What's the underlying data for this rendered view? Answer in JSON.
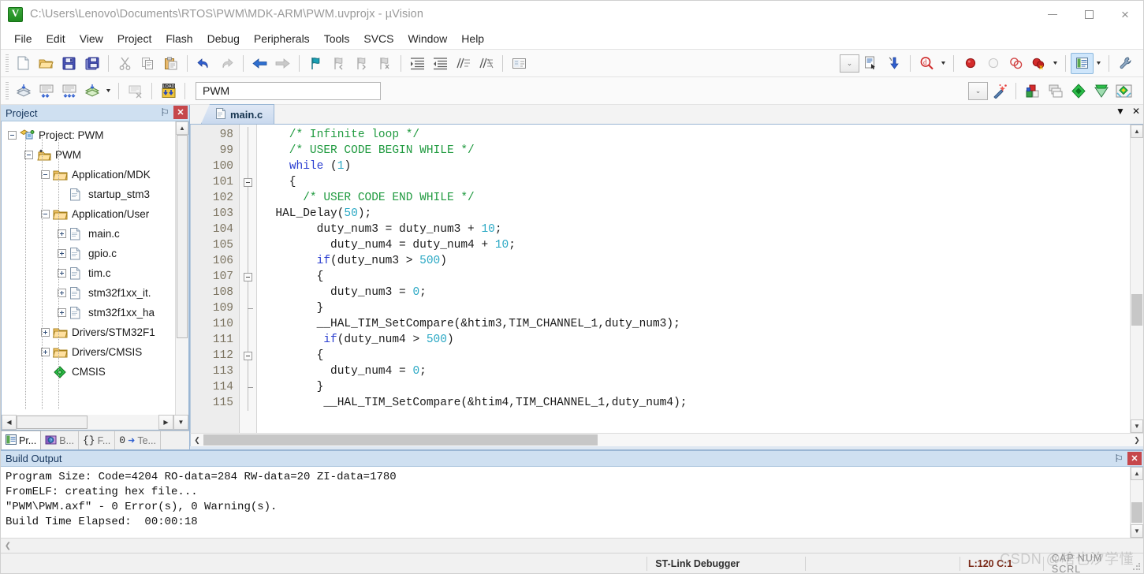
{
  "window": {
    "title": "C:\\Users\\Lenovo\\Documents\\RTOS\\PWM\\MDK-ARM\\PWM.uvprojx - µVision",
    "minimize_label": "",
    "maximize_label": "",
    "close_label": "×"
  },
  "menu": {
    "items": [
      {
        "label": "File"
      },
      {
        "label": "Edit"
      },
      {
        "label": "View"
      },
      {
        "label": "Project"
      },
      {
        "label": "Flash"
      },
      {
        "label": "Debug"
      },
      {
        "label": "Peripherals"
      },
      {
        "label": "Tools"
      },
      {
        "label": "SVCS"
      },
      {
        "label": "Window"
      },
      {
        "label": "Help"
      }
    ]
  },
  "toolbar_main": {
    "buttons": [
      {
        "name": "new-file-icon",
        "tooltip": "New"
      },
      {
        "name": "open-file-icon",
        "tooltip": "Open"
      },
      {
        "name": "save-icon",
        "tooltip": "Save"
      },
      {
        "name": "save-all-icon",
        "tooltip": "Save All"
      },
      {
        "name": "cut-icon",
        "tooltip": "Cut"
      },
      {
        "name": "copy-icon",
        "tooltip": "Copy"
      },
      {
        "name": "paste-icon",
        "tooltip": "Paste"
      },
      {
        "name": "undo-icon",
        "tooltip": "Undo"
      },
      {
        "name": "redo-icon",
        "tooltip": "Redo"
      },
      {
        "name": "navigate-back-icon",
        "tooltip": "Back"
      },
      {
        "name": "navigate-forward-icon",
        "tooltip": "Forward"
      },
      {
        "name": "bookmark-toggle-icon",
        "tooltip": "Insert/Remove Bookmark"
      },
      {
        "name": "bookmark-prev-icon",
        "tooltip": "Previous Bookmark"
      },
      {
        "name": "bookmark-next-icon",
        "tooltip": "Next Bookmark"
      },
      {
        "name": "bookmark-clear-icon",
        "tooltip": "Clear All Bookmarks"
      },
      {
        "name": "indent-icon",
        "tooltip": "Indent"
      },
      {
        "name": "outdent-icon",
        "tooltip": "Outdent"
      },
      {
        "name": "comment-icon",
        "tooltip": "Comment"
      },
      {
        "name": "uncomment-icon",
        "tooltip": "Uncomment"
      },
      {
        "name": "open-configuration-icon",
        "tooltip": "Configuration Wizard"
      }
    ]
  },
  "toolbar_right": {
    "buttons": [
      {
        "name": "target-options-dropdown",
        "tooltip": "Select Target"
      },
      {
        "name": "show-disassembly-icon",
        "tooltip": "Disassembly Window"
      },
      {
        "name": "start-debug-icon",
        "tooltip": "Start/Stop Debug Session"
      },
      {
        "name": "find-in-files-icon",
        "tooltip": "Find in Files"
      },
      {
        "name": "breakpoint-insert-icon",
        "tooltip": "Insert/Remove Breakpoint"
      },
      {
        "name": "breakpoint-disable-icon",
        "tooltip": "Enable/Disable Breakpoint"
      },
      {
        "name": "breakpoint-disable-all-icon",
        "tooltip": "Disable All Breakpoints"
      },
      {
        "name": "breakpoint-kill-all-icon",
        "tooltip": "Kill All Breakpoints"
      },
      {
        "name": "manage-windows-icon",
        "tooltip": "Manage Window Layout"
      },
      {
        "name": "configure-tools-icon",
        "tooltip": "Configure"
      }
    ]
  },
  "toolbar_build": {
    "buttons": [
      {
        "name": "translate-icon",
        "tooltip": "Translate File"
      },
      {
        "name": "build-icon",
        "tooltip": "Build"
      },
      {
        "name": "rebuild-icon",
        "tooltip": "Rebuild"
      },
      {
        "name": "batch-build-icon",
        "tooltip": "Batch Build"
      },
      {
        "name": "stop-build-icon",
        "tooltip": "Stop Build"
      },
      {
        "name": "download-icon",
        "tooltip": "Download",
        "label": "LOAD"
      },
      {
        "name": "target-wizard-icon",
        "tooltip": "Start Wizard"
      },
      {
        "name": "target-options-icon",
        "tooltip": "Options for Target"
      },
      {
        "name": "manage-project-items-icon",
        "tooltip": "Manage Project Items"
      },
      {
        "name": "pack-installer-icon",
        "tooltip": "Pack Installer"
      },
      {
        "name": "manage-rte-icon",
        "tooltip": "Manage Run-Time Environment"
      },
      {
        "name": "select-software-packs-icon",
        "tooltip": "Select Software Packs"
      }
    ],
    "target_value": "PWM"
  },
  "project_panel": {
    "title": "Project",
    "pin_label": "⚐",
    "close_label": "✕",
    "tree": [
      {
        "label": "Project: PWM",
        "indent": 0,
        "expander": "minus",
        "icon": "project-icon"
      },
      {
        "label": "PWM",
        "indent": 1,
        "expander": "minus",
        "icon": "target-icon"
      },
      {
        "label": "Application/MDK",
        "indent": 2,
        "expander": "minus",
        "icon": "folder-icon"
      },
      {
        "label": "startup_stm3",
        "indent": 3,
        "expander": "none",
        "icon": "file-icon"
      },
      {
        "label": "Application/User",
        "indent": 2,
        "expander": "minus",
        "icon": "folder-icon"
      },
      {
        "label": "main.c",
        "indent": 3,
        "expander": "plus",
        "icon": "file-icon"
      },
      {
        "label": "gpio.c",
        "indent": 3,
        "expander": "plus",
        "icon": "file-icon"
      },
      {
        "label": "tim.c",
        "indent": 3,
        "expander": "plus",
        "icon": "file-icon"
      },
      {
        "label": "stm32f1xx_it.",
        "indent": 3,
        "expander": "plus",
        "icon": "file-icon"
      },
      {
        "label": "stm32f1xx_ha",
        "indent": 3,
        "expander": "plus",
        "icon": "file-icon"
      },
      {
        "label": "Drivers/STM32F1",
        "indent": 2,
        "expander": "plus",
        "icon": "folder-icon"
      },
      {
        "label": "Drivers/CMSIS",
        "indent": 2,
        "expander": "plus",
        "icon": "folder-icon"
      },
      {
        "label": "CMSIS",
        "indent": 2,
        "expander": "none",
        "icon": "cmsis-icon"
      }
    ],
    "tabs": [
      {
        "label": "Pr...",
        "icon": "project-tab-icon",
        "selected": true
      },
      {
        "label": "B...",
        "icon": "books-tab-icon",
        "selected": false
      },
      {
        "label": "F...",
        "icon": "functions-tab-icon",
        "selected": false
      },
      {
        "label": "Te...",
        "icon": "templates-tab-icon",
        "selected": false
      }
    ]
  },
  "editor": {
    "tabs": [
      {
        "label": "main.c",
        "icon": "c-file-icon",
        "selected": true
      }
    ],
    "tab_dropdown_label": "▼",
    "tab_close_label": "✕",
    "first_line": 98,
    "lines": [
      {
        "n": 98,
        "fold": "none",
        "segments": [
          {
            "t": "    /* Infinite loop */",
            "c": "comment"
          }
        ]
      },
      {
        "n": 99,
        "fold": "none",
        "segments": [
          {
            "t": "    /* USER CODE BEGIN WHILE */",
            "c": "comment"
          }
        ]
      },
      {
        "n": 100,
        "fold": "none",
        "segments": [
          {
            "t": "    ",
            "c": "plain"
          },
          {
            "t": "while",
            "c": "keyword"
          },
          {
            "t": " (",
            "c": "plain"
          },
          {
            "t": "1",
            "c": "number"
          },
          {
            "t": ")",
            "c": "plain"
          }
        ]
      },
      {
        "n": 101,
        "fold": "start",
        "segments": [
          {
            "t": "    {",
            "c": "plain"
          }
        ]
      },
      {
        "n": 102,
        "fold": "none",
        "segments": [
          {
            "t": "      /* USER CODE END WHILE */",
            "c": "comment"
          }
        ]
      },
      {
        "n": 103,
        "fold": "none",
        "segments": [
          {
            "t": "  HAL_Delay(",
            "c": "plain"
          },
          {
            "t": "50",
            "c": "number"
          },
          {
            "t": ");",
            "c": "plain"
          }
        ]
      },
      {
        "n": 104,
        "fold": "none",
        "segments": [
          {
            "t": "        duty_num3 = duty_num3 + ",
            "c": "plain"
          },
          {
            "t": "10",
            "c": "number"
          },
          {
            "t": ";",
            "c": "plain"
          }
        ]
      },
      {
        "n": 105,
        "fold": "none",
        "segments": [
          {
            "t": "          duty_num4 = duty_num4 + ",
            "c": "plain"
          },
          {
            "t": "10",
            "c": "number"
          },
          {
            "t": ";",
            "c": "plain"
          }
        ]
      },
      {
        "n": 106,
        "fold": "none",
        "segments": [
          {
            "t": "        ",
            "c": "plain"
          },
          {
            "t": "if",
            "c": "keyword"
          },
          {
            "t": "(duty_num3 > ",
            "c": "plain"
          },
          {
            "t": "500",
            "c": "number"
          },
          {
            "t": ")",
            "c": "plain"
          }
        ]
      },
      {
        "n": 107,
        "fold": "start",
        "segments": [
          {
            "t": "        {",
            "c": "plain"
          }
        ]
      },
      {
        "n": 108,
        "fold": "none",
        "segments": [
          {
            "t": "          duty_num3 = ",
            "c": "plain"
          },
          {
            "t": "0",
            "c": "number"
          },
          {
            "t": ";",
            "c": "plain"
          }
        ]
      },
      {
        "n": 109,
        "fold": "end",
        "segments": [
          {
            "t": "        }",
            "c": "plain"
          }
        ]
      },
      {
        "n": 110,
        "fold": "none",
        "segments": [
          {
            "t": "        __HAL_TIM_SetCompare(&htim3,TIM_CHANNEL_1,duty_num3);",
            "c": "plain"
          }
        ]
      },
      {
        "n": 111,
        "fold": "none",
        "segments": [
          {
            "t": "         ",
            "c": "plain"
          },
          {
            "t": "if",
            "c": "keyword"
          },
          {
            "t": "(duty_num4 > ",
            "c": "plain"
          },
          {
            "t": "500",
            "c": "number"
          },
          {
            "t": ")",
            "c": "plain"
          }
        ]
      },
      {
        "n": 112,
        "fold": "start",
        "segments": [
          {
            "t": "        {",
            "c": "plain"
          }
        ]
      },
      {
        "n": 113,
        "fold": "none",
        "segments": [
          {
            "t": "          duty_num4 = ",
            "c": "plain"
          },
          {
            "t": "0",
            "c": "number"
          },
          {
            "t": ";",
            "c": "plain"
          }
        ]
      },
      {
        "n": 114,
        "fold": "end",
        "segments": [
          {
            "t": "        }",
            "c": "plain"
          }
        ]
      },
      {
        "n": 115,
        "fold": "none",
        "segments": [
          {
            "t": "         __HAL_TIM_SetCompare(&htim4,TIM_CHANNEL_1,duty_num4);",
            "c": "plain"
          }
        ]
      }
    ]
  },
  "build_output": {
    "title": "Build Output",
    "pin_label": "⚐",
    "close_label": "✕",
    "lines": [
      "Program Size: Code=4204 RO-data=284 RW-data=20 ZI-data=1780",
      "FromELF: creating hex file...",
      "\"PWM\\PWM.axf\" - 0 Error(s), 0 Warning(s).",
      "Build Time Elapsed:  00:00:18"
    ]
  },
  "status_bar": {
    "debugger": "ST-Link Debugger",
    "position": "L:120 C:1",
    "keys": "CAP NUM SCRL",
    "watermark": "CSDN @啥也汐学懂"
  },
  "colors": {
    "accent_blue": "#cfe0f1",
    "panel_border": "#9ab6d4",
    "comment_green": "#1f9a3f",
    "keyword_blue": "#2b3fd0",
    "number_teal": "#2aa8c4",
    "close_red": "#c6474b"
  }
}
